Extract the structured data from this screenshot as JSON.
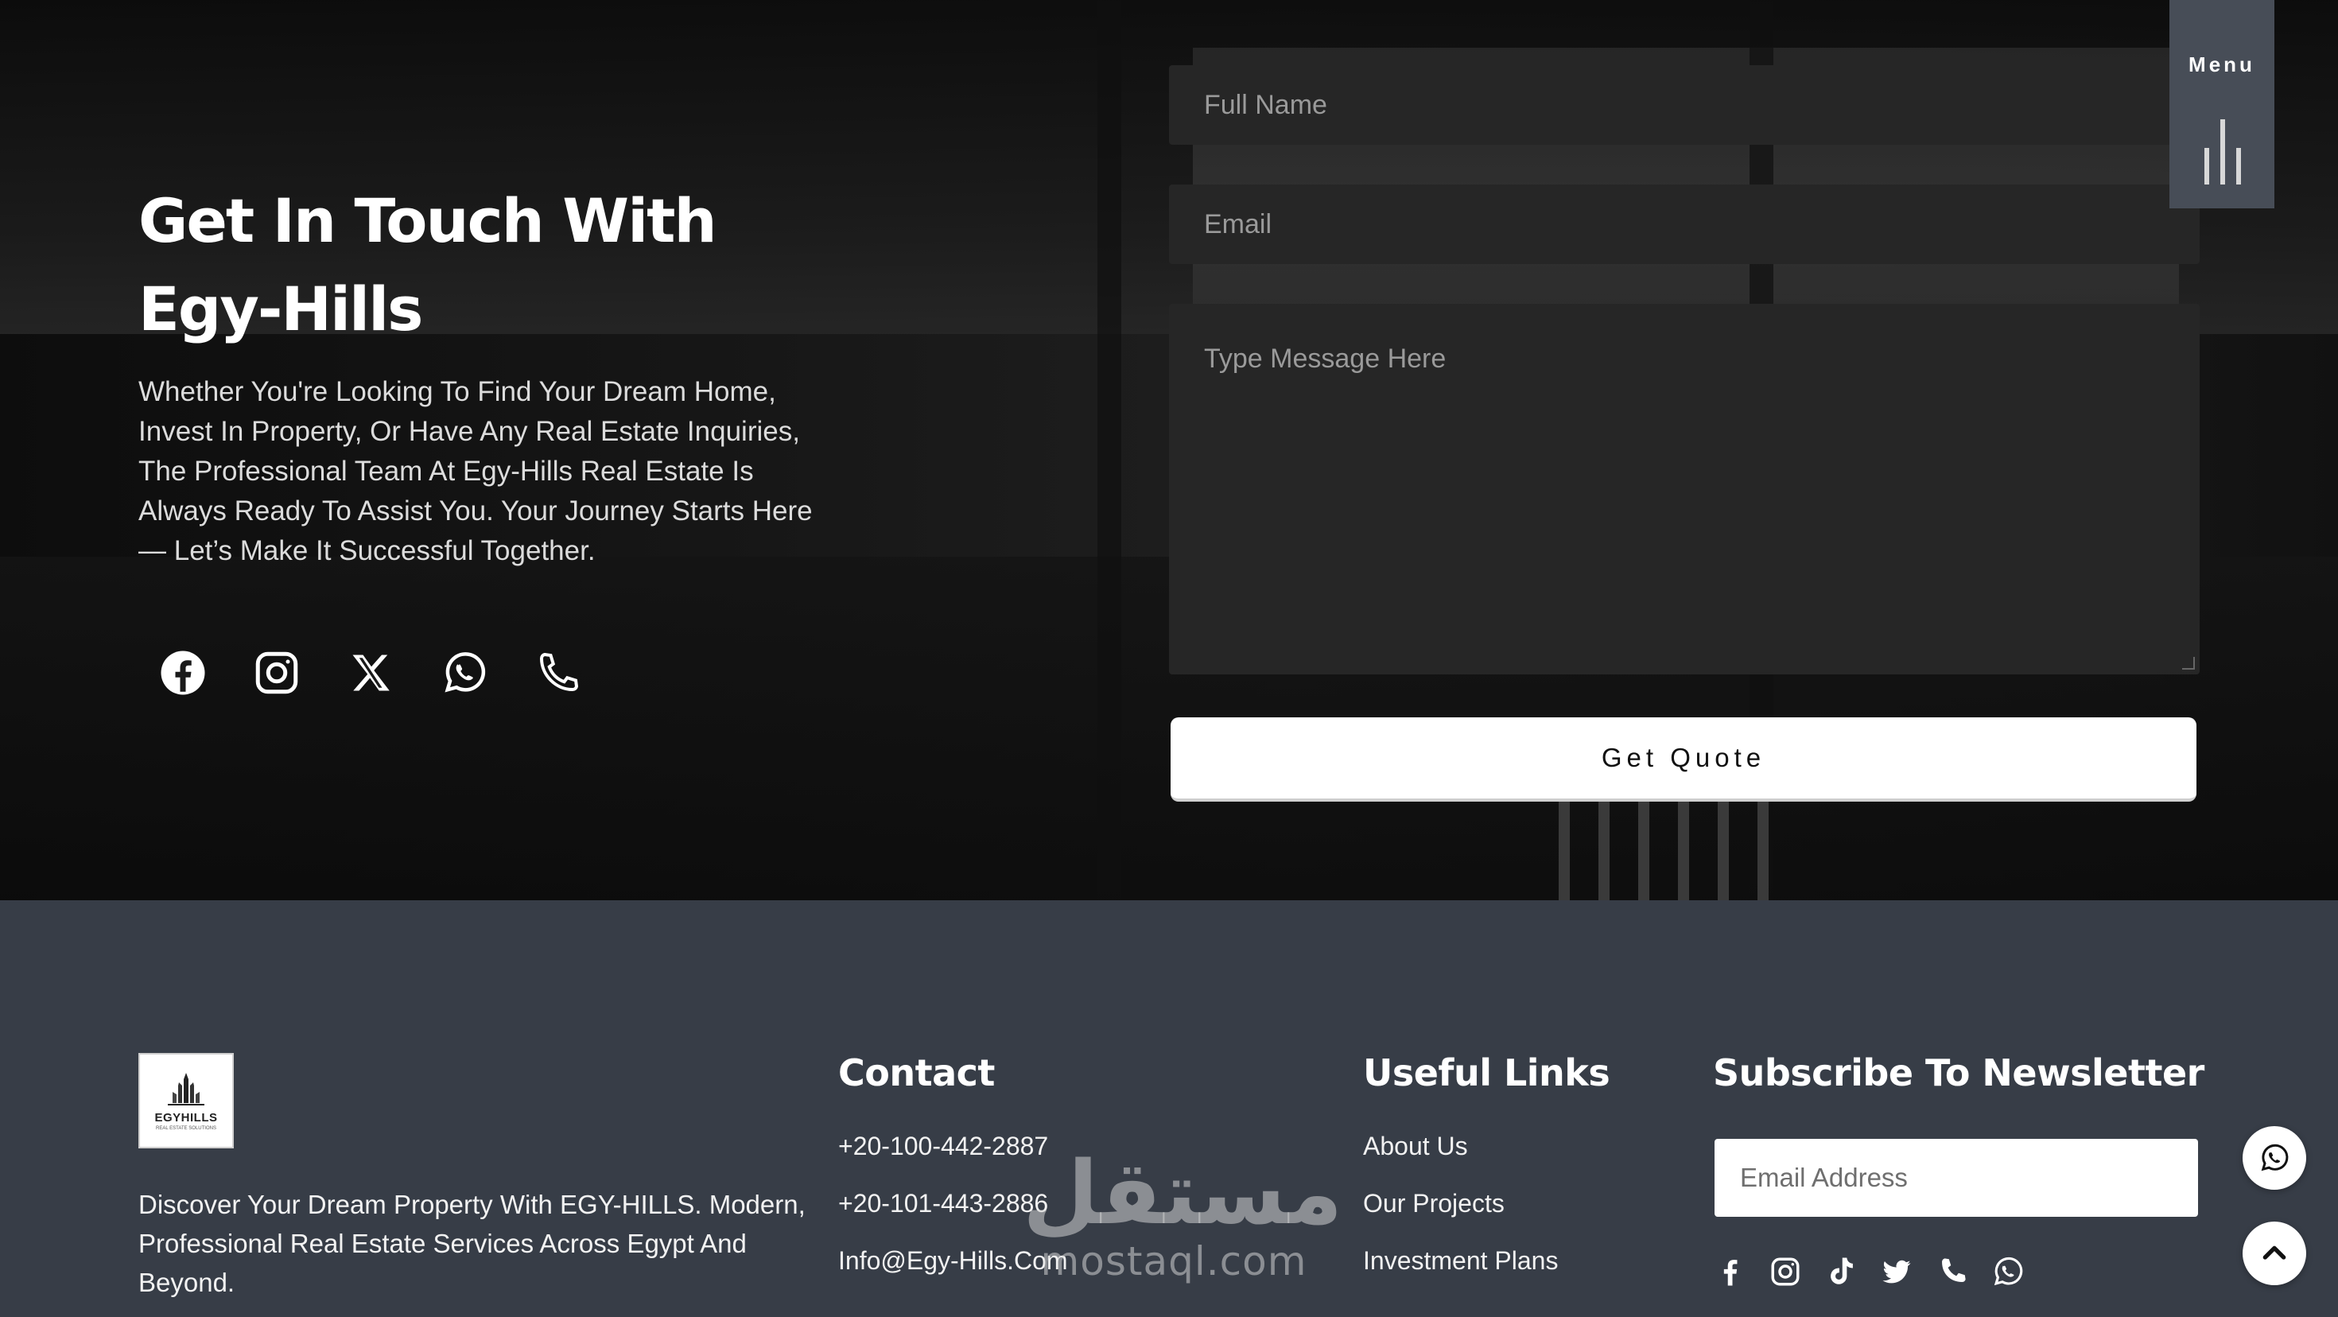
{
  "menu": {
    "label": "Menu"
  },
  "contact_section": {
    "title": "Get In Touch With Egy-Hills",
    "description": "Whether You're Looking To Find Your Dream Home, Invest In Property, Or Have Any Real Estate Inquiries, The Professional Team At Egy-Hills Real Estate Is Always Ready To Assist You. Your Journey Starts Here — Let’s Make It Successful Together.",
    "social_icons": [
      "facebook-icon",
      "instagram-icon",
      "x-icon",
      "whatsapp-icon",
      "phone-icon"
    ],
    "form": {
      "name_placeholder": "Full Name",
      "email_placeholder": "Email",
      "message_placeholder": "Type Message Here",
      "submit_label": "Get Quote"
    }
  },
  "footer": {
    "logo": {
      "name": "EGYHILLS",
      "tagline": "REAL ESTATE SOLUTIONS"
    },
    "about": "Discover Your Dream Property With EGY-HILLS. Modern, Professional Real Estate Services Across Egypt And Beyond.",
    "contact": {
      "heading": "Contact",
      "items": [
        "+20-100-442-2887",
        "+20-101-443-2886",
        "Info@Egy-Hills.Com"
      ]
    },
    "useful_links": {
      "heading": "Useful Links",
      "items": [
        "About Us",
        "Our Projects",
        "Investment Plans"
      ]
    },
    "newsletter": {
      "heading": "Subscribe To Newsletter",
      "email_placeholder": "Email Address",
      "social_icons": [
        "facebook-icon",
        "instagram-icon",
        "tiktok-icon",
        "twitter-icon",
        "phone-icon",
        "whatsapp-icon"
      ]
    }
  },
  "floating_buttons": [
    "whatsapp-icon",
    "chevron-up-icon"
  ],
  "watermark": {
    "arabic": "مستقل",
    "latin": "mostaql.com"
  },
  "colors": {
    "footer_bg": "#373d47",
    "menu_tab_bg": "#474d57",
    "input_bg": "#262626",
    "button_bg": "#ffffff"
  }
}
